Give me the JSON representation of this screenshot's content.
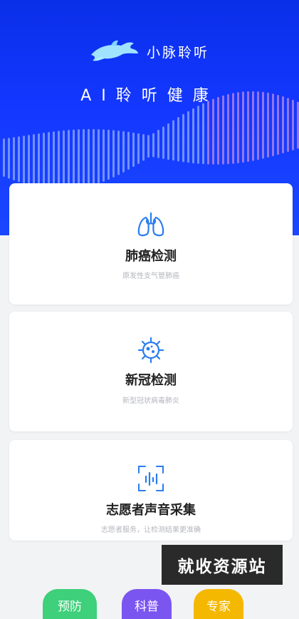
{
  "hero": {
    "brand_name": "小脉聆听",
    "slogan": "AI聆听健康",
    "logo_icon": "dolphin-icon",
    "colors": {
      "primary": "#1437ff"
    }
  },
  "cards": [
    {
      "title": "肺癌检测",
      "subtitle": "原发性支气管肺癌",
      "icon": "lungs-icon"
    },
    {
      "title": "新冠检测",
      "subtitle": "新型冠状病毒肺炎",
      "icon": "virus-icon"
    },
    {
      "title": "志愿者声音采集",
      "subtitle": "志愿者服务，让检测结果更准确",
      "icon": "voice-scan-icon"
    }
  ],
  "watermark": "就收资源站",
  "bottom_buttons": [
    {
      "label": "预防",
      "color": "#3ed07a"
    },
    {
      "label": "科普",
      "color": "#7b55f0"
    },
    {
      "label": "专家",
      "color": "#f5b800"
    }
  ]
}
